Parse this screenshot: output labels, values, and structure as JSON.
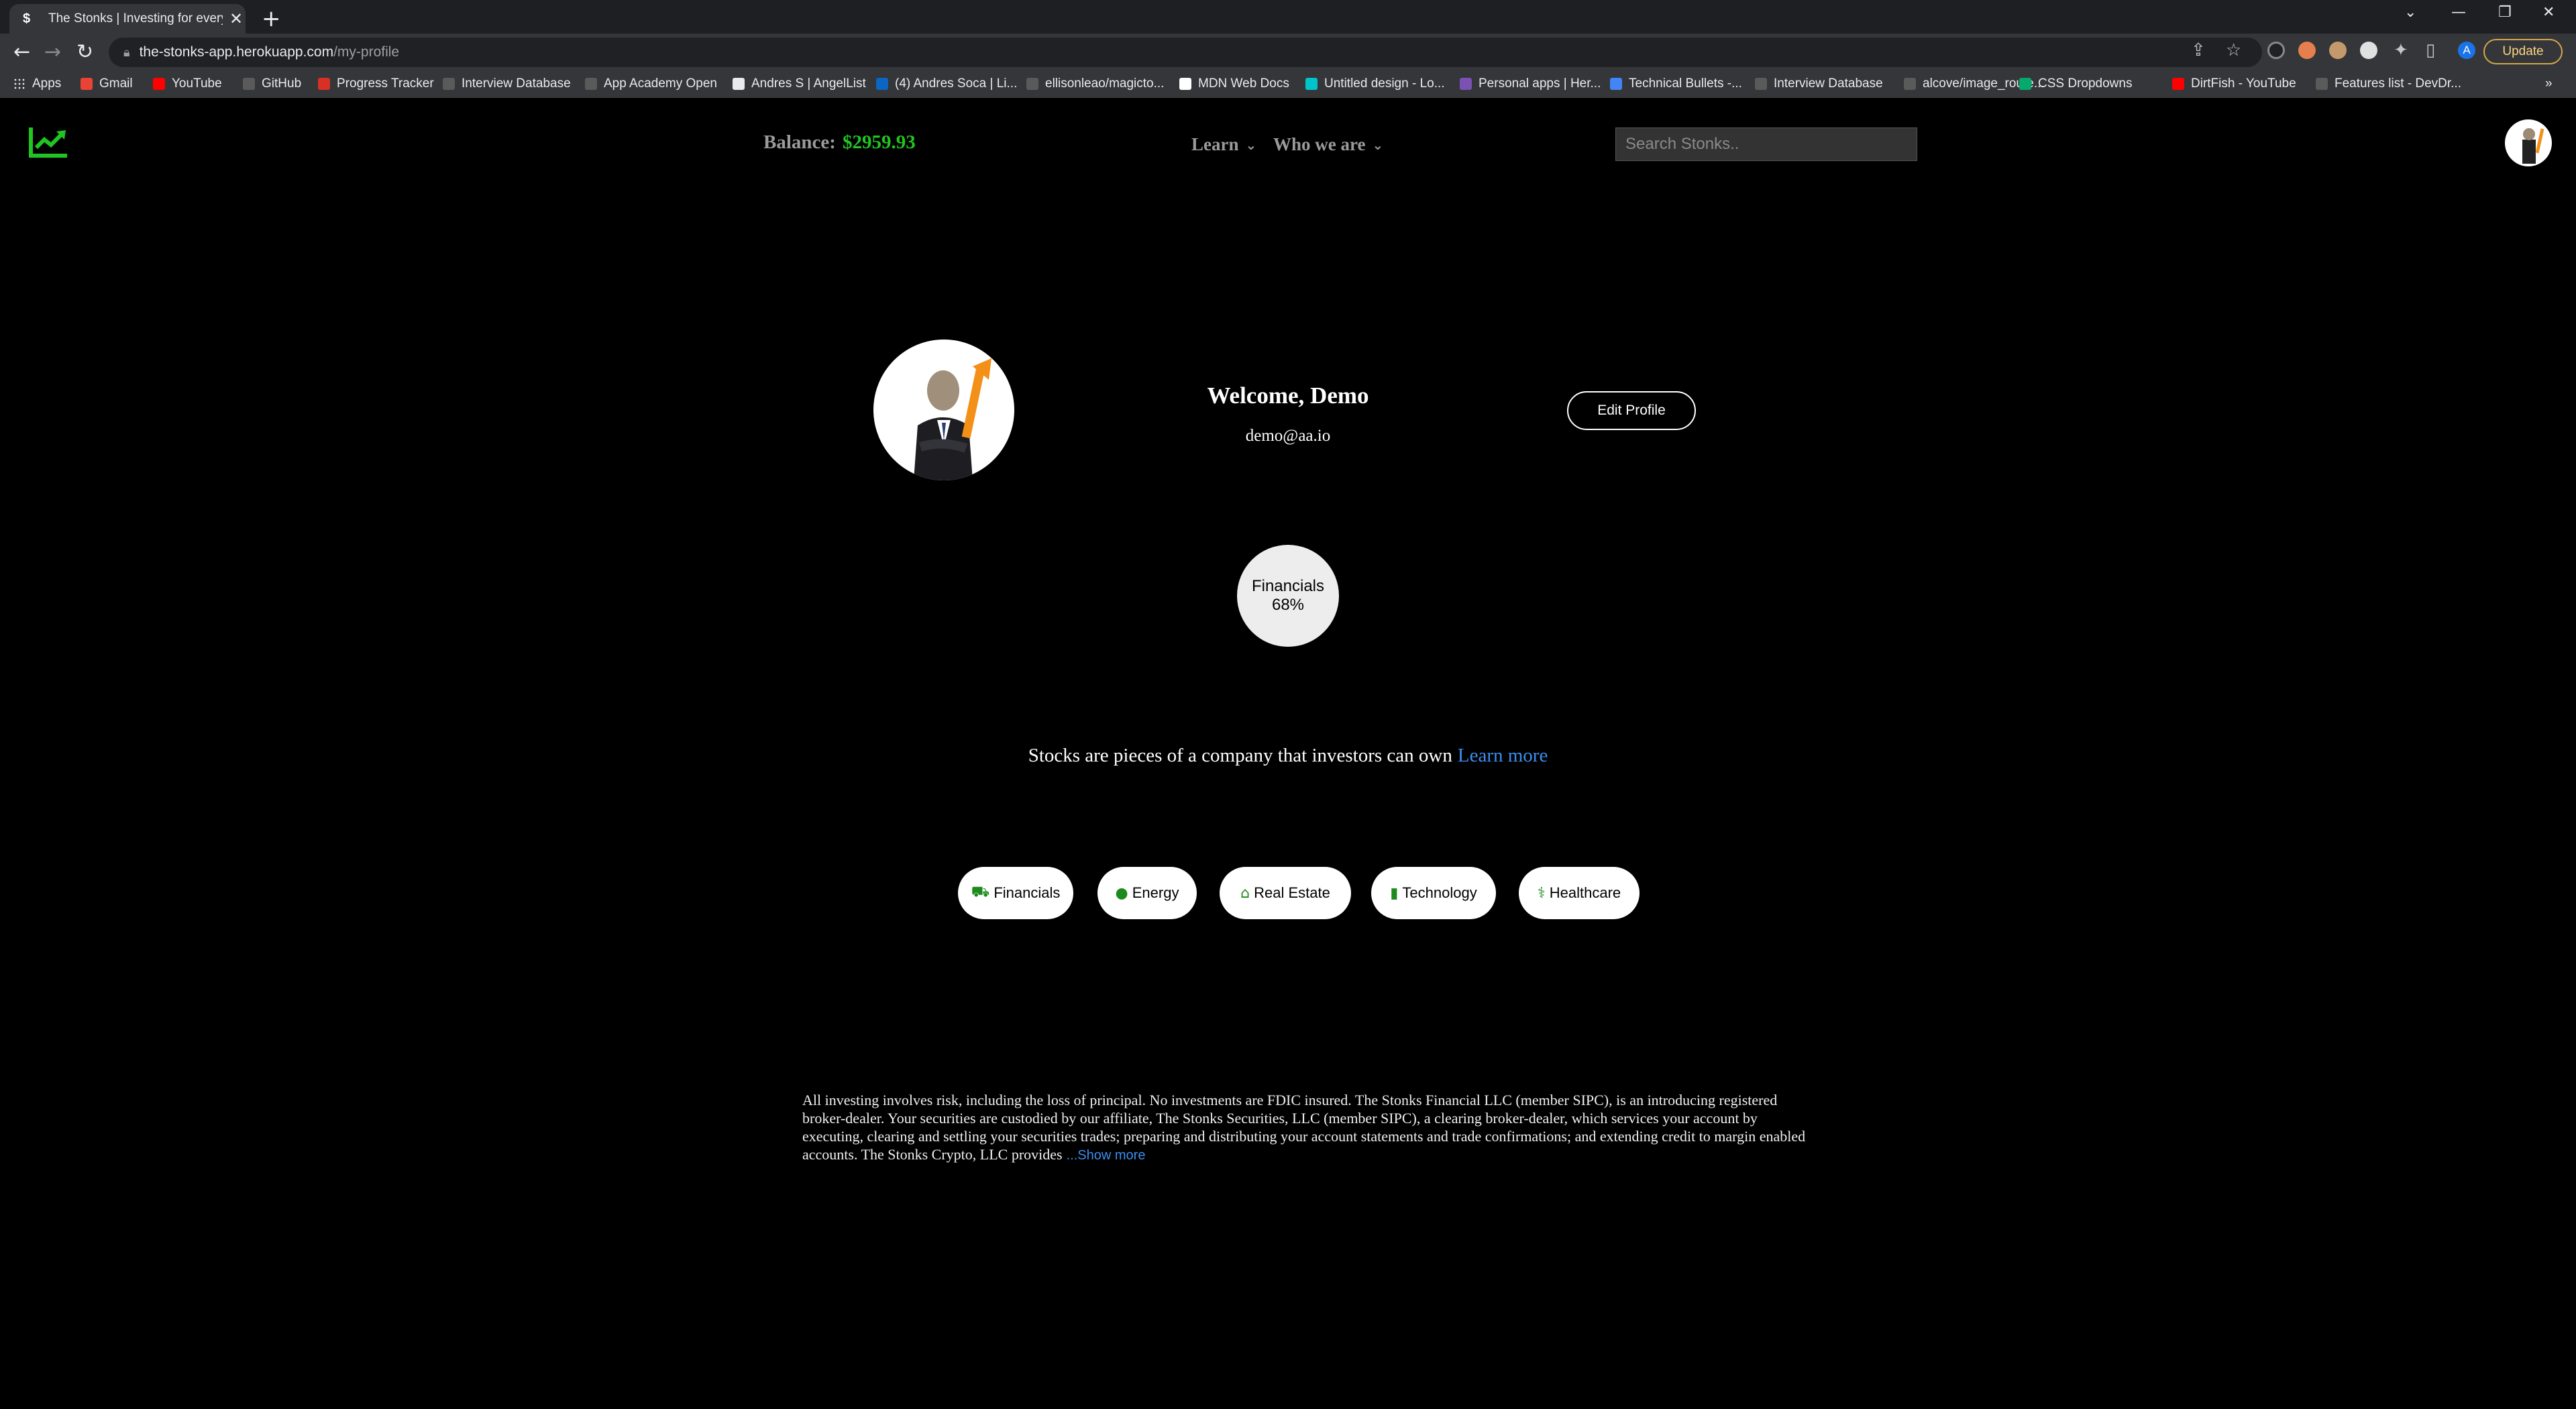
{
  "browser": {
    "tab_title": "The Stonks | Investing for everyone",
    "tab_favicon": "$",
    "url_host": "the-stonks-app.herokuapp.com",
    "url_path": "/my-profile",
    "profile_initial": "A",
    "update_label": "Update",
    "bookmarks": [
      {
        "label": "Apps",
        "icon": "apps-grid-icon"
      },
      {
        "label": "Gmail",
        "icon": "gmail-icon"
      },
      {
        "label": "YouTube",
        "icon": "youtube-icon"
      },
      {
        "label": "GitHub",
        "icon": "github-icon"
      },
      {
        "label": "Progress Tracker",
        "icon": "progress-tracker-icon"
      },
      {
        "label": "Interview Database",
        "icon": "globe-icon"
      },
      {
        "label": "App Academy Open",
        "icon": "globe-icon"
      },
      {
        "label": "Andres S | AngelList",
        "icon": "angellist-icon"
      },
      {
        "label": "(4) Andres Soca | Li...",
        "icon": "linkedin-icon"
      },
      {
        "label": "ellisonleao/magicto...",
        "icon": "github-icon"
      },
      {
        "label": "MDN Web Docs",
        "icon": "mdn-icon"
      },
      {
        "label": "Untitled design - Lo...",
        "icon": "canva-icon"
      },
      {
        "label": "Personal apps | Her...",
        "icon": "heroku-icon"
      },
      {
        "label": "Technical Bullets -...",
        "icon": "docs-icon"
      },
      {
        "label": "Interview Database",
        "icon": "globe-icon"
      },
      {
        "label": "alcove/image_route...",
        "icon": "github-icon"
      },
      {
        "label": "CSS Dropdowns",
        "icon": "w3schools-icon"
      },
      {
        "label": "DirtFish - YouTube",
        "icon": "youtube-icon"
      },
      {
        "label": "Features list - DevDr...",
        "icon": "globe-icon"
      }
    ]
  },
  "header": {
    "balance_label": "Balance:",
    "balance_value": "$2959.93",
    "learn_label": "Learn",
    "who_label": "Who we are",
    "search_placeholder": "Search Stonks.."
  },
  "profile": {
    "welcome": "Welcome, Demo",
    "email": "demo@aa.io",
    "edit_label": "Edit Profile"
  },
  "holdings": {
    "sector": "Financials",
    "percent": "68%"
  },
  "tagline": {
    "text": "Stocks are pieces of a company that investors can own",
    "link": "Learn more"
  },
  "categories": [
    {
      "label": "Financials",
      "icon": "truck-money-icon"
    },
    {
      "label": "Energy",
      "icon": "lightbulb-icon"
    },
    {
      "label": "Real Estate",
      "icon": "house-icon"
    },
    {
      "label": "Technology",
      "icon": "mobile-icon"
    },
    {
      "label": "Healthcare",
      "icon": "stethoscope-icon"
    }
  ],
  "disclaimer": {
    "text": "All investing involves risk, including the loss of principal. No investments are FDIC insured. The Stonks Financial LLC (member SIPC), is an introducing registered broker-dealer. Your securities are custodied by our affiliate, The Stonks Securities, LLC (member SIPC), a clearing broker-dealer, which services your account by executing, clearing and settling your securities trades; preparing and distributing your account statements and trade confirmations; and extending credit to margin enabled accounts. The Stonks Crypto, LLC provides",
    "more": "...Show more"
  },
  "colors": {
    "accent_green": "#21c521",
    "link_blue": "#3a8ef0",
    "background": "#000000"
  }
}
